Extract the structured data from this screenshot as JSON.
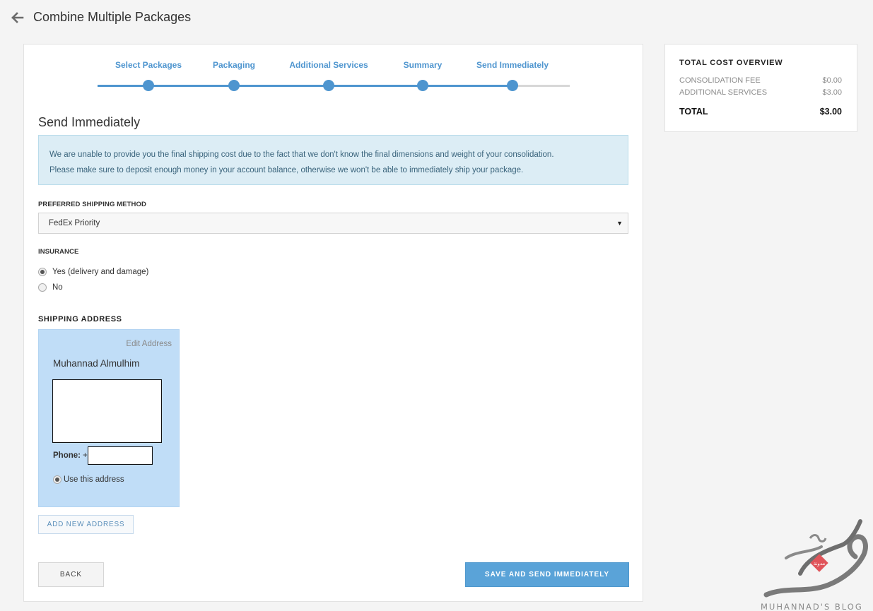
{
  "header": {
    "title": "Combine Multiple Packages",
    "back_icon": "arrow-left-icon"
  },
  "stepper": {
    "steps": [
      "Select Packages",
      "Packaging",
      "Additional Services",
      "Summary",
      "Send Immediately"
    ],
    "current_step": 5,
    "progress_fraction": 0.88,
    "accent": "#4e95cf"
  },
  "main": {
    "section_title": "Send Immediately",
    "info_lines": [
      "We are unable to provide you the final shipping cost due to the fact that we don't know the final dimensions and weight of your consolidation.",
      "Please make sure to deposit enough money in your account balance, otherwise we won't be able to immediately ship your package."
    ],
    "shipping_method": {
      "label": "PREFERRED SHIPPING METHOD",
      "selected": "FedEx Priority"
    },
    "insurance": {
      "label": "INSURANCE",
      "options": [
        {
          "label": "Yes (delivery and damage)",
          "checked": true
        },
        {
          "label": "No",
          "checked": false
        }
      ]
    },
    "shipping_address": {
      "heading": "SHIPPING ADDRESS",
      "edit_label": "Edit Address",
      "name": "Muhannad Almulhim",
      "phone_label": "Phone:",
      "phone_prefix": "+",
      "use_label": "Use this address",
      "use_checked": true
    },
    "add_address_label": "ADD NEW ADDRESS",
    "back_label": "BACK",
    "submit_label": "SAVE AND SEND IMMEDIATELY"
  },
  "cost_overview": {
    "title": "TOTAL COST OVERVIEW",
    "rows": [
      {
        "label": "CONSOLIDATION FEE",
        "value": "$0.00"
      },
      {
        "label": "ADDITIONAL SERVICES",
        "value": "$3.00"
      }
    ],
    "total_label": "TOTAL",
    "total_value": "$3.00"
  },
  "watermark": {
    "text": "MUHANNAD'S BLOG",
    "badge": "مدونة"
  }
}
